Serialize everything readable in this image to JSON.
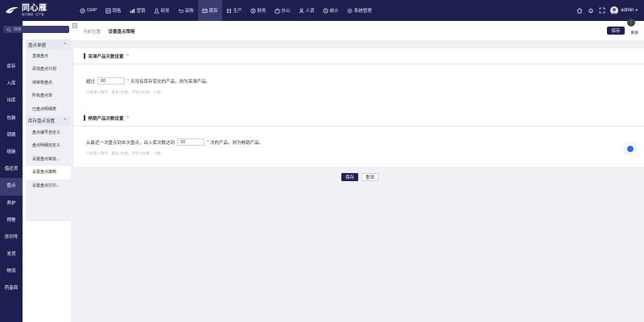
{
  "app": {
    "title": "同心雁",
    "subtitle": "医疗器械 · 生产版"
  },
  "topnav": [
    {
      "label": "GMP",
      "icon": "gmp-icon"
    },
    {
      "label": "销售",
      "icon": "sales-icon"
    },
    {
      "label": "营销",
      "icon": "marketing-icon"
    },
    {
      "label": "研发",
      "icon": "rnd-icon"
    },
    {
      "label": "采购",
      "icon": "purchase-icon"
    },
    {
      "label": "库存",
      "icon": "inventory-icon",
      "active": true
    },
    {
      "label": "生产",
      "icon": "production-icon"
    },
    {
      "label": "财务",
      "icon": "finance-icon"
    },
    {
      "label": "办公",
      "icon": "office-icon"
    },
    {
      "label": "人资",
      "icon": "hr-icon"
    },
    {
      "label": "统计",
      "icon": "stats-icon"
    },
    {
      "label": "系统管理",
      "icon": "settings-icon"
    }
  ],
  "user": {
    "name": "admin"
  },
  "search": {
    "placeholder": "搜索"
  },
  "rail": [
    {
      "label": "库存"
    },
    {
      "label": "入库"
    },
    {
      "label": "出库"
    },
    {
      "label": "包装"
    },
    {
      "label": "调拨"
    },
    {
      "label": "组装"
    },
    {
      "label": "借还货"
    },
    {
      "label": "盘点",
      "active": true
    },
    {
      "label": "养护"
    },
    {
      "label": "预警"
    },
    {
      "label": "序列号"
    },
    {
      "label": "发货"
    },
    {
      "label": "物流"
    },
    {
      "label": "药监局"
    }
  ],
  "submenu": {
    "group1": {
      "label": "盘点单据",
      "items": [
        "直接盘点",
        "添加盘点计划",
        "待审核盘点",
        "所有盘点单",
        "已盘点明细表"
      ]
    },
    "group2": {
      "label": "库存盘点设置",
      "items": [
        "盘点编号自定义",
        "盘点明细自定义",
        "设置盘点审批...",
        "设置盘点策略",
        "设置盘点打印..."
      ]
    }
  },
  "breadcrumb": {
    "prefix": "当前位置:",
    "current": "设置盘点策略"
  },
  "actions": {
    "save": "保存",
    "reset": "重填"
  },
  "section1": {
    "title": "呆滞产品天数设置",
    "text_before": "超过",
    "value": "60",
    "text_after": "天没有库存变化的产品，则为呆滞产品。",
    "hint": "只能输入数字，最多4位数，不能为负数，小数。"
  },
  "section2": {
    "title": "畅销产品次数设置",
    "text_before": "从最近一次盘点到本次盘点，出入库次数达到",
    "value": "20",
    "text_after": "次的产品，则为畅销产品。",
    "hint": "只能输入数字，最多4位数，不能为负数，小数。"
  }
}
